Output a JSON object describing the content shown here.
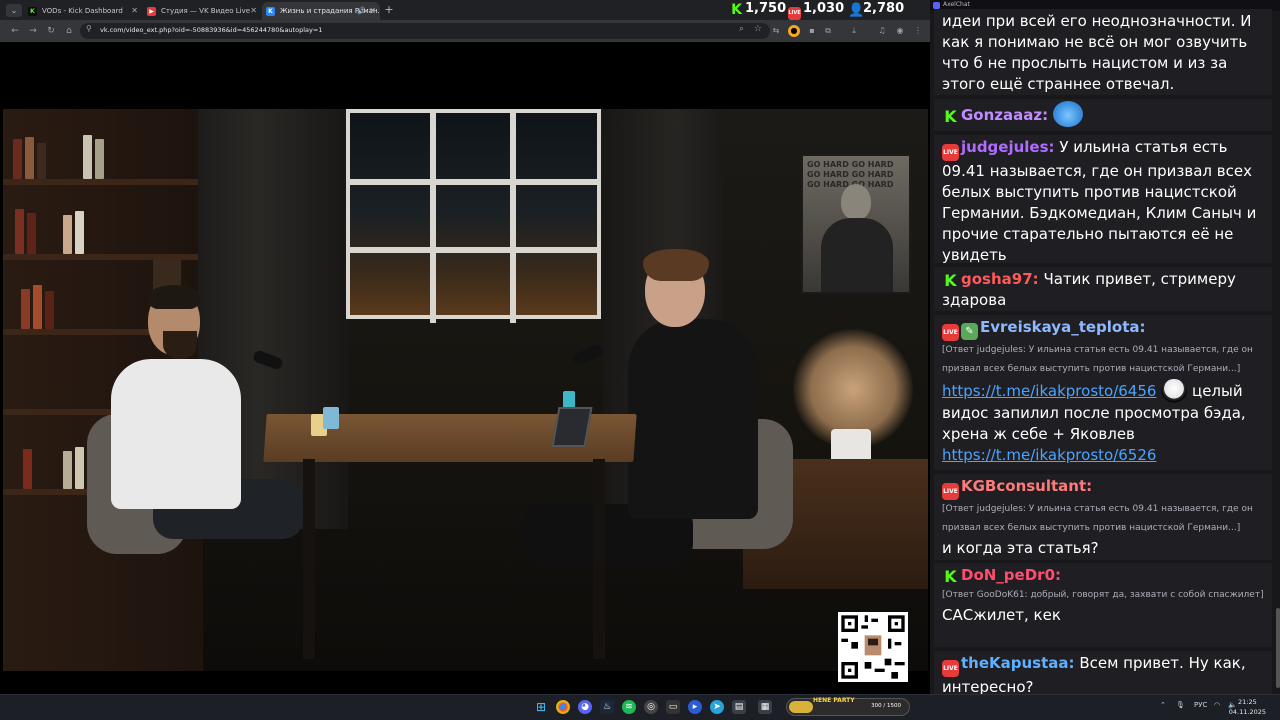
{
  "browser": {
    "tabs": [
      {
        "label": "VODs - Kick Dashboard",
        "icon": "kick-favicon",
        "color": "#53fc18"
      },
      {
        "label": "Студия — VK Видео Live",
        "icon": "vk-live-favicon",
        "color": "#e63b3b"
      },
      {
        "label": "Жизнь и страдания Роман...",
        "icon": "vk-favicon",
        "color": "#2787f5",
        "active": true
      }
    ],
    "url": "vk.com/video_ext.php?oid=-50883936&id=456244780&autoplay=1"
  },
  "counters": {
    "kick": "1,750",
    "vk_live": "1,030",
    "total": "2,780"
  },
  "chat_app": {
    "title": "AxelChat"
  },
  "chat": [
    {
      "id": "m0",
      "user": "",
      "text": "идеи при всей его неоднозначности. И как я понимаю не всё он мог озвучить что б не прослыть нацистом и из за этого ещё страннее отвечал."
    },
    {
      "id": "m1",
      "platform": "kick",
      "user": "Gonzaaaz:",
      "color": "#c08cff",
      "emote": "cat-emote"
    },
    {
      "id": "m2",
      "platform": "live",
      "user": "judgejules:",
      "color": "#b06cff",
      "text": "У ильина статья есть 09.41 называется, где он призвал всех белых выступить против нацистской Германии. Бэдкомедиан, Клим Саныч и прочие старательно пытаются её не увидеть"
    },
    {
      "id": "m3",
      "platform": "kick",
      "user": "gosha97:",
      "color": "#ff5a5a",
      "text": "Чатик привет, стримеру здарова"
    },
    {
      "id": "m4",
      "platform": "live",
      "user": "Evreiskaya_teplota:",
      "color": "#8fb8ff",
      "reply": "[Ответ judgejules: У ильина статья есть 09.41 называется, где он призвал всех белых выступить против нацистской Германи...]",
      "link1": "https://t.me/ikakprosto/6456",
      "text": "целый видос запилил после просмотра бэда, хрена ж себе + Яковлев",
      "link2": "https://t.me/ikakprosto/6526"
    },
    {
      "id": "m5",
      "platform": "live",
      "user": "KGBconsultant:",
      "color": "#ff7a7a",
      "reply": "[Ответ judgejules: У ильина статья есть 09.41 называется, где он призвал всех белых выступить против нацистской Германи...]",
      "text": "и когда эта статья?"
    },
    {
      "id": "m6",
      "platform": "kick",
      "user": "DoN_peDr0:",
      "color": "#ff4d6d",
      "reply": "[Ответ GooDoK61: добрый, говорят да, захвати с собой спасжилет]",
      "text": "САСжилет, кек"
    },
    {
      "id": "m7",
      "platform": "live",
      "user": "theKapustaa:",
      "color": "#5fb0ff",
      "text": "Всем привет. Ну как, интересно?"
    }
  ],
  "taskbar": {
    "overlay_label": "HENE PARTY",
    "overlay_count": "300 / 1500",
    "overlay_progress": 0.2,
    "lang": "РУС",
    "time": "21:25",
    "date": "04.11.2025"
  }
}
